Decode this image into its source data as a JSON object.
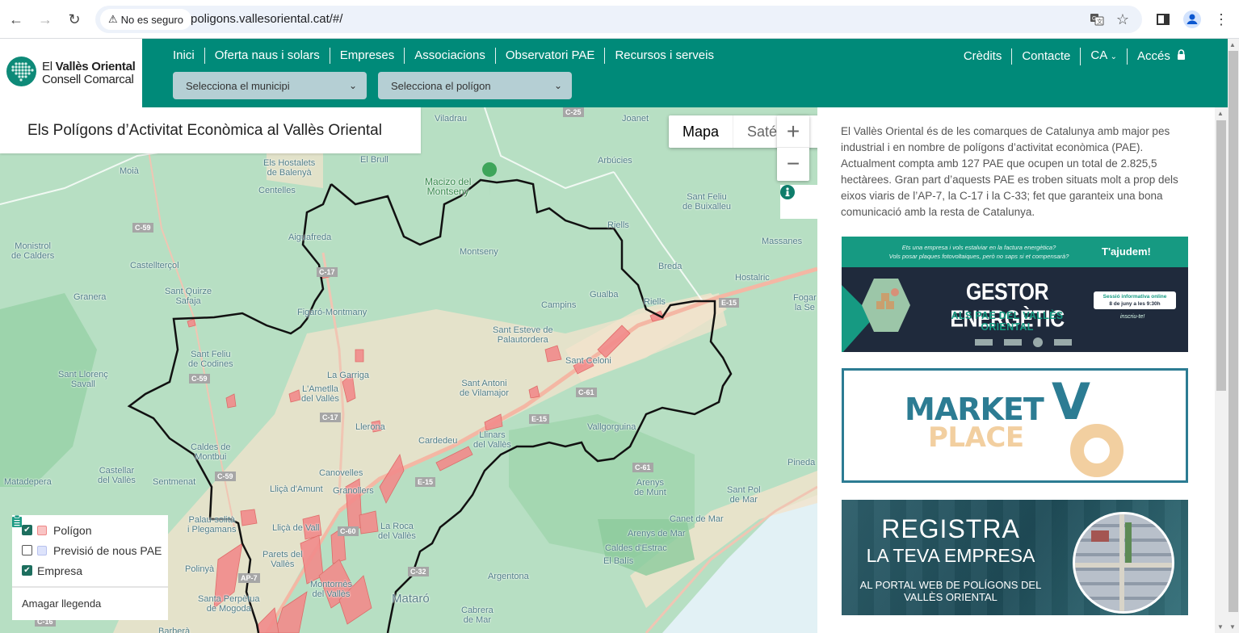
{
  "browser": {
    "security_label": "No es seguro",
    "url": "poligons.vallesoriental.cat/#/",
    "icons": [
      "back-icon",
      "forward-icon",
      "reload-icon",
      "warning-icon",
      "translate-icon",
      "star-icon",
      "sidepanel-icon",
      "profile-icon",
      "kebab-menu-icon"
    ]
  },
  "logo": {
    "line1_prefix": "El ",
    "line1_bold": "Vallès Oriental",
    "line2": "Consell Comarcal"
  },
  "nav": {
    "main": [
      "Inici",
      "Oferta naus i solars",
      "Empreses",
      "Associacions",
      "Observatori PAE",
      "Recursos i serveis"
    ],
    "right": {
      "credits": "Crèdits",
      "contact": "Contacte",
      "lang": "CA",
      "access": "Accés"
    },
    "municipi_select": "Selecciona el municipi",
    "poligon_select": "Selecciona el polígon"
  },
  "colors": {
    "brand": "#008a79",
    "polygon": "#f28b8b",
    "forecast": "#c9d3f5",
    "company_pin": "#d0021b"
  },
  "map": {
    "title": "Els Polígons d’Activitat Econòmica al Vallès Oriental",
    "type_map": "Mapa",
    "type_satellite": "Saté",
    "zoom_in": "+",
    "zoom_out": "−",
    "labels": {
      "viladrau": "Viladrau",
      "joanet": "Joanet",
      "moia": "Moià",
      "hostalets1": "Els Hostalets",
      "hostalets2": "de Balenyà",
      "elbrull": "El Brull",
      "arbucies": "Arbúcies",
      "macizo1": "Macizo del",
      "macizo2": "Montseny",
      "centelles": "Centelles",
      "stfeliub1": "Sant Feliu",
      "stfeliub2": "de Buixalleu",
      "monistrol1": "Monistrol",
      "monistrol2": "de Calders",
      "aiguafreda": "Aiguafreda",
      "riells": "Riells",
      "massanes": "Massanes",
      "castellterçol": "Castellterçol",
      "montseny": "Montseny",
      "breda": "Breda",
      "hostalric": "Hostalric",
      "granera": "Granera",
      "stquirze1": "Sant Quirze",
      "stquirze2": "Safaja",
      "gualba": "Gualba",
      "riells2": "Riells",
      "figaro": "Figaró-Montmany",
      "campins": "Campins",
      "fogars1": "Fogar",
      "fogars2": "la Se",
      "stesteve1": "Sant Esteve de",
      "stesteve2": "Palautordera",
      "stfeliuc1": "Sant Feliu",
      "stfeliuc2": "de Codines",
      "stceloni": "Sant Celoni",
      "stllorenc1": "Sant Llorenç",
      "stllorenc2": "Savall",
      "lagarriga": "La Garriga",
      "stantoni1": "Sant Antoni",
      "stantoni2": "de Vilamajor",
      "ametlla1": "L'Ametlla",
      "ametlla2": "del Vallès",
      "llerona": "Llerona",
      "vallgorguina": "Vallgorguina",
      "cardedeu": "Cardedeu",
      "llinars1": "Llinars",
      "llinars2": "del Vallès",
      "caldes1": "Caldes de",
      "caldes2": "Montbui",
      "castellar1": "Castellar",
      "castellar2": "del Vallès",
      "canovelles": "Canovelles",
      "pineda": "Pineda",
      "matadepera": "Matadepera",
      "sentmenat": "Sentmenat",
      "llica": "Lliçà d'Amunt",
      "granollers": "Granollers",
      "arenysm1": "Arenys",
      "arenysm2": "de Munt",
      "stpol1": "Sant Pol",
      "stpol2": "de Mar",
      "palau1": "Palau-solità",
      "palau2": "i Plegamans",
      "llicav": "Lliçà de Vall",
      "laroca1": "La Roca",
      "laroca2": "del Vallès",
      "canet": "Canet de Mar",
      "parets1": "Parets del",
      "parets2": "Vallès",
      "arenys": "Arenys de Mar",
      "caldesestrac": "Caldes d'Estrac",
      "polinya": "Polinyà",
      "elbalis": "El Balís",
      "montornes1": "Montornès",
      "montornes2": "del Vallès",
      "argentona": "Argentona",
      "stperpetua1": "Santa Perpètua",
      "stperpetua2": "de Mogoda",
      "mataro": "Mataró",
      "cabrera1": "Cabrera",
      "cabrera2": "de Mar",
      "barbera": "Barberà"
    },
    "roads": {
      "c25": "C-25",
      "c59a": "C-59",
      "c17a": "C-17",
      "c59b": "C-59",
      "e15a": "E-15",
      "c17b": "C-17",
      "c59c": "C-59",
      "c61a": "C-61",
      "e15b": "E-15",
      "c61b": "C-61",
      "e15c": "E-15",
      "c60": "C-60",
      "ap7": "AP-7",
      "c32": "C-32",
      "c16": "C-16"
    }
  },
  "legend": {
    "items": [
      {
        "label": "Polígon",
        "checked": true
      },
      {
        "label": "Previsió de nous PAE",
        "checked": false
      },
      {
        "label": "Empresa",
        "checked": true
      }
    ],
    "hide": "Amagar llegenda"
  },
  "panel": {
    "intro": "El Vallès Oriental és de les comarques de Catalunya amb major pes industrial i en nombre de polígons d’activitat econòmica (PAE). Actualment compta amb 127 PAE que ocupen un total de 2.825,5 hectàrees. Gran part d’aquests PAE es troben situats molt a prop dels eixos viaris de l’AP-7, la C-17 i la C-33; fet que garanteix una bona comunicació amb la resta de Catalunya.",
    "banner1": {
      "question1": "Ets una empresa i vols estalviar en la factura energètica?",
      "question2": "Vols posar plaques fotovoltaiques, però no saps si et compensarà?",
      "cta": "T'ajudem!",
      "title": "GESTOR ENERGÈTIC",
      "subtitle": "ALS PAE DEL VALLÈS ORIENTAL",
      "session": "Sessió informativa online",
      "date": "8 de juny a les 9:30h",
      "signup": "inscriu-te!"
    },
    "banner2": {
      "market": "MARKET",
      "place": "PLACE",
      "v": "V",
      "o": "O"
    },
    "banner3": {
      "line1": "REGISTRA",
      "line2": "LA TEVA EMPRESA",
      "line3": "AL PORTAL WEB DE POLÍGONS DEL",
      "line4": "VALLÈS ORIENTAL"
    }
  }
}
